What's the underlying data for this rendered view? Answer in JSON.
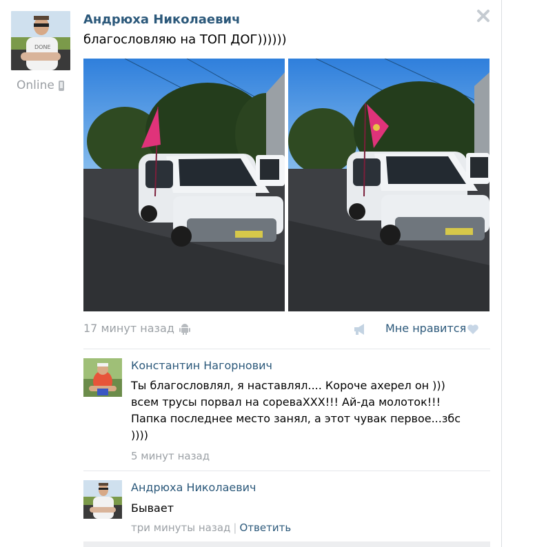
{
  "post": {
    "author": "Андрюха Николаевич",
    "status": "Online",
    "text": "благословляю на ТОП ДОГ))))))",
    "time": "17 минут назад",
    "like_label": "Мне нравится"
  },
  "comments": [
    {
      "author": "Константин Нагорнович",
      "lines": [
        "Ты благословлял, я наставлял.... Короче ахерел он )))",
        "всем трусы порвал на сореваXXX!!! Ай-да молоток!!!",
        "Папка последнее место занял, а этот чувак первое...збс",
        "))))"
      ],
      "time": "5 минут назад"
    },
    {
      "author": "Андрюха Николаевич",
      "text": "Бывает",
      "time": "три минуты назад",
      "reply_label": "Ответить"
    }
  ],
  "colors": {
    "link": "#2b587a",
    "meta": "#9ba0a5",
    "divider": "#e4e6e9"
  },
  "icons": [
    "phone-icon",
    "close-icon",
    "android-icon",
    "share-icon",
    "heart-icon"
  ]
}
